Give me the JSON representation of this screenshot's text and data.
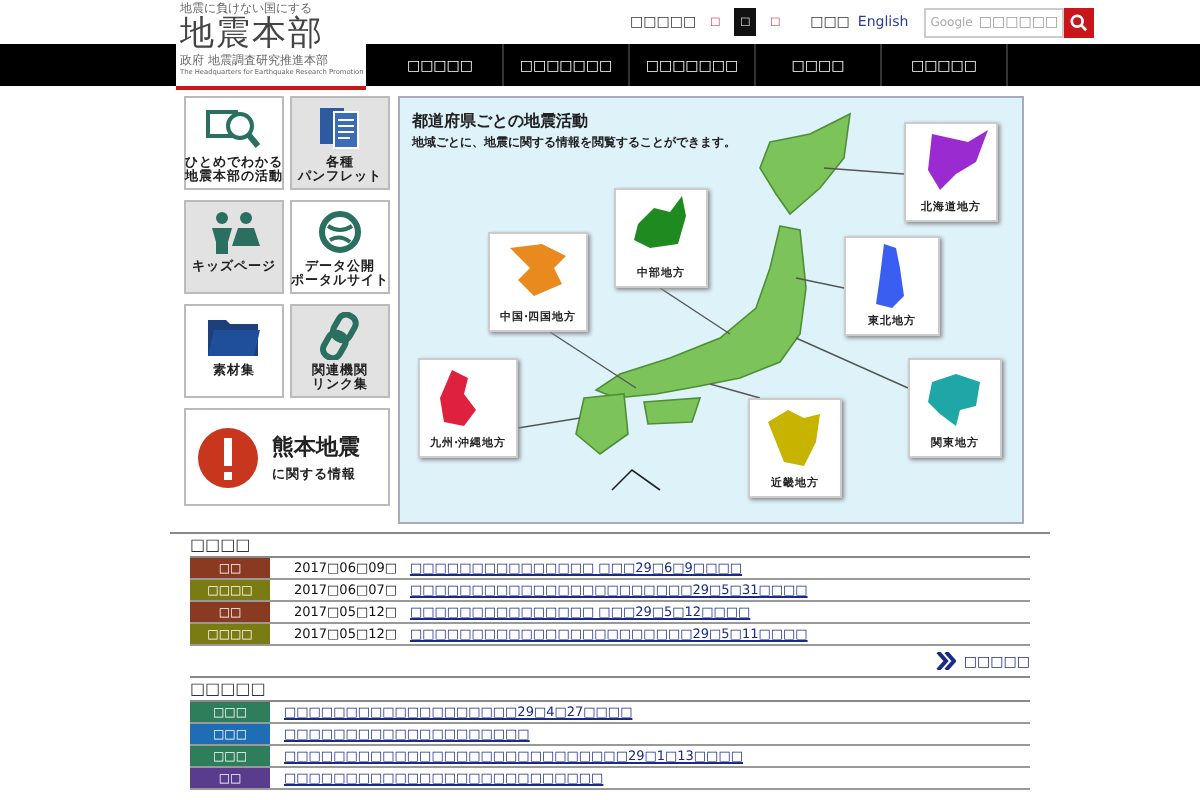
{
  "header": {
    "logo": {
      "tagline": "地震に負けない国にする",
      "title": "地震本部",
      "org": "政府 地震調査研究推進本部",
      "english": "The Headquarters for Earthquake Research Promotion"
    },
    "utility": {
      "font_label": "□□□□□",
      "size_buttons": [
        {
          "label": "□",
          "selected": false
        },
        {
          "label": "□",
          "selected": true
        },
        {
          "label": "□",
          "selected": false
        }
      ],
      "lang_label": "□□□",
      "english": "English",
      "search": {
        "brand": "Google",
        "placeholder": "□□□□□□"
      }
    },
    "nav": [
      "□□□□□",
      "□□□□□□□",
      "□□□□□□□",
      "□□□□",
      "□□□□□"
    ]
  },
  "tiles": [
    {
      "lines": [
        "ひとめでわかる",
        "地震本部の活動"
      ],
      "color": "#ffffff"
    },
    {
      "lines": [
        "各種",
        "パンフレット"
      ],
      "color": "#e2e2e2"
    },
    {
      "lines": [
        "キッズページ"
      ],
      "color": "#e2e2e2"
    },
    {
      "lines": [
        "データ公開",
        "ポータルサイト"
      ],
      "color": "#ffffff"
    },
    {
      "lines": [
        "素材集"
      ],
      "color": "#ffffff"
    },
    {
      "lines": [
        "関連機関",
        "リンク集"
      ],
      "color": "#e2e2e2"
    }
  ],
  "feature": {
    "title": "熊本地震",
    "subtitle": "に関する情報"
  },
  "map": {
    "title": "都道府県ごとの地震活動",
    "subtitle": "地域ごとに、地震に関する情報を閲覧することができます。",
    "regions": [
      {
        "name": "北海道地方",
        "color": "#9a2bd0"
      },
      {
        "name": "東北地方",
        "color": "#3a5ef0"
      },
      {
        "name": "関東地方",
        "color": "#1fa7a7"
      },
      {
        "name": "近畿地方",
        "color": "#c6b400"
      },
      {
        "name": "中部地方",
        "color": "#1f8a1f"
      },
      {
        "name": "中国·四国地方",
        "color": "#e98a1e"
      },
      {
        "name": "九州·沖縄地方",
        "color": "#e0203f"
      }
    ]
  },
  "news": {
    "heading": "□□□□",
    "more": "□□□□□",
    "rows": [
      {
        "badge": "□□",
        "color": "#8b3a22",
        "date": "2017□06□09□",
        "text": "□□□□□□□□□□□□□□□ □□□29□6□9□□□□"
      },
      {
        "badge": "□□□□",
        "color": "#7b7b14",
        "date": "2017□06□07□",
        "text": "□□□□□□□□□□□□□□□□□□□□□□□29□5□31□□□□"
      },
      {
        "badge": "□□",
        "color": "#8b3a22",
        "date": "2017□05□12□",
        "text": "□□□□□□□□□□□□□□□ □□□29□5□12□□□□"
      },
      {
        "badge": "□□□□",
        "color": "#7b7b14",
        "date": "2017□05□12□",
        "text": "□□□□□□□□□□□□□□□□□□□□□□□29□5□11□□□□"
      }
    ]
  },
  "updates": {
    "heading": "□□□□□",
    "rows": [
      {
        "badge": "□□□",
        "color": "#2e7d5b",
        "text": "□□□□□□□□□□□□□□□□□□□29□4□27□□□□"
      },
      {
        "badge": "□□□",
        "color": "#1f6db5",
        "text": "□□□□□□□□□□□□□□□□□□□□"
      },
      {
        "badge": "□□□",
        "color": "#2e7d5b",
        "text": "□□□□□□□□□□□□□□□□□□□□□□□□□□□□29□1□13□□□□"
      },
      {
        "badge": "□□",
        "color": "#5a3c8f",
        "text": "□□□□□□□□□□□□□□□□□□□□□□□□□□"
      }
    ]
  }
}
